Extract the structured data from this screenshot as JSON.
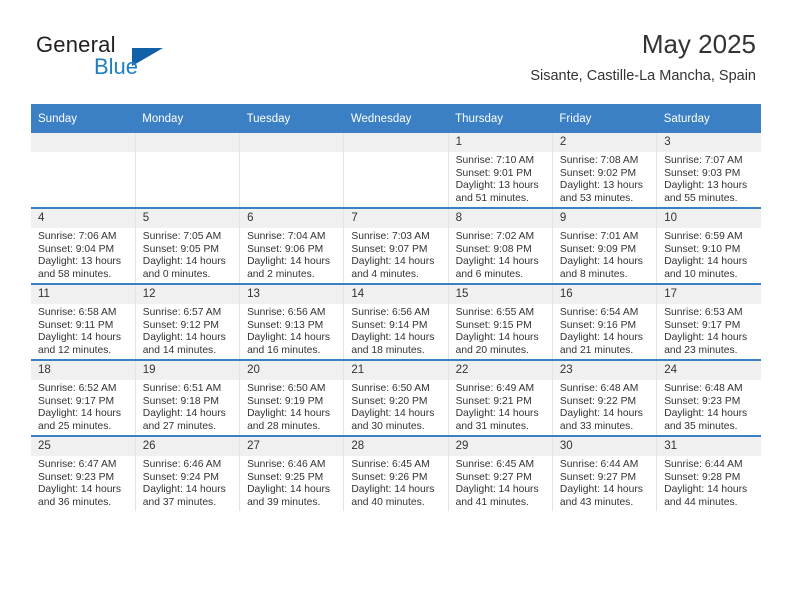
{
  "logo": {
    "word_one": "General",
    "word_two": "Blue",
    "triangle_color": "#1260a8",
    "blue_color": "#1f7fc4"
  },
  "header": {
    "title": "May 2025",
    "subtitle": "Sisante, Castille-La Mancha, Spain"
  },
  "theme": {
    "header_blue": "#3b7fc4",
    "daynum_band": "#f0f0f0",
    "text": "#333333"
  },
  "calendar": {
    "weekday_headers": [
      "Sunday",
      "Monday",
      "Tuesday",
      "Wednesday",
      "Thursday",
      "Friday",
      "Saturday"
    ],
    "weeks": [
      [
        {
          "day": "",
          "empty": true,
          "sunrise": "",
          "sunset": "",
          "daylight_line1": "",
          "daylight_line2": ""
        },
        {
          "day": "",
          "empty": true,
          "sunrise": "",
          "sunset": "",
          "daylight_line1": "",
          "daylight_line2": ""
        },
        {
          "day": "",
          "empty": true,
          "sunrise": "",
          "sunset": "",
          "daylight_line1": "",
          "daylight_line2": ""
        },
        {
          "day": "",
          "empty": true,
          "sunrise": "",
          "sunset": "",
          "daylight_line1": "",
          "daylight_line2": ""
        },
        {
          "day": "1",
          "sunrise": "Sunrise: 7:10 AM",
          "sunset": "Sunset: 9:01 PM",
          "daylight_line1": "Daylight: 13 hours",
          "daylight_line2": "and 51 minutes."
        },
        {
          "day": "2",
          "sunrise": "Sunrise: 7:08 AM",
          "sunset": "Sunset: 9:02 PM",
          "daylight_line1": "Daylight: 13 hours",
          "daylight_line2": "and 53 minutes."
        },
        {
          "day": "3",
          "sunrise": "Sunrise: 7:07 AM",
          "sunset": "Sunset: 9:03 PM",
          "daylight_line1": "Daylight: 13 hours",
          "daylight_line2": "and 55 minutes."
        }
      ],
      [
        {
          "day": "4",
          "sunrise": "Sunrise: 7:06 AM",
          "sunset": "Sunset: 9:04 PM",
          "daylight_line1": "Daylight: 13 hours",
          "daylight_line2": "and 58 minutes."
        },
        {
          "day": "5",
          "sunrise": "Sunrise: 7:05 AM",
          "sunset": "Sunset: 9:05 PM",
          "daylight_line1": "Daylight: 14 hours",
          "daylight_line2": "and 0 minutes."
        },
        {
          "day": "6",
          "sunrise": "Sunrise: 7:04 AM",
          "sunset": "Sunset: 9:06 PM",
          "daylight_line1": "Daylight: 14 hours",
          "daylight_line2": "and 2 minutes."
        },
        {
          "day": "7",
          "sunrise": "Sunrise: 7:03 AM",
          "sunset": "Sunset: 9:07 PM",
          "daylight_line1": "Daylight: 14 hours",
          "daylight_line2": "and 4 minutes."
        },
        {
          "day": "8",
          "sunrise": "Sunrise: 7:02 AM",
          "sunset": "Sunset: 9:08 PM",
          "daylight_line1": "Daylight: 14 hours",
          "daylight_line2": "and 6 minutes."
        },
        {
          "day": "9",
          "sunrise": "Sunrise: 7:01 AM",
          "sunset": "Sunset: 9:09 PM",
          "daylight_line1": "Daylight: 14 hours",
          "daylight_line2": "and 8 minutes."
        },
        {
          "day": "10",
          "sunrise": "Sunrise: 6:59 AM",
          "sunset": "Sunset: 9:10 PM",
          "daylight_line1": "Daylight: 14 hours",
          "daylight_line2": "and 10 minutes."
        }
      ],
      [
        {
          "day": "11",
          "sunrise": "Sunrise: 6:58 AM",
          "sunset": "Sunset: 9:11 PM",
          "daylight_line1": "Daylight: 14 hours",
          "daylight_line2": "and 12 minutes."
        },
        {
          "day": "12",
          "sunrise": "Sunrise: 6:57 AM",
          "sunset": "Sunset: 9:12 PM",
          "daylight_line1": "Daylight: 14 hours",
          "daylight_line2": "and 14 minutes."
        },
        {
          "day": "13",
          "sunrise": "Sunrise: 6:56 AM",
          "sunset": "Sunset: 9:13 PM",
          "daylight_line1": "Daylight: 14 hours",
          "daylight_line2": "and 16 minutes."
        },
        {
          "day": "14",
          "sunrise": "Sunrise: 6:56 AM",
          "sunset": "Sunset: 9:14 PM",
          "daylight_line1": "Daylight: 14 hours",
          "daylight_line2": "and 18 minutes."
        },
        {
          "day": "15",
          "sunrise": "Sunrise: 6:55 AM",
          "sunset": "Sunset: 9:15 PM",
          "daylight_line1": "Daylight: 14 hours",
          "daylight_line2": "and 20 minutes."
        },
        {
          "day": "16",
          "sunrise": "Sunrise: 6:54 AM",
          "sunset": "Sunset: 9:16 PM",
          "daylight_line1": "Daylight: 14 hours",
          "daylight_line2": "and 21 minutes."
        },
        {
          "day": "17",
          "sunrise": "Sunrise: 6:53 AM",
          "sunset": "Sunset: 9:17 PM",
          "daylight_line1": "Daylight: 14 hours",
          "daylight_line2": "and 23 minutes."
        }
      ],
      [
        {
          "day": "18",
          "sunrise": "Sunrise: 6:52 AM",
          "sunset": "Sunset: 9:17 PM",
          "daylight_line1": "Daylight: 14 hours",
          "daylight_line2": "and 25 minutes."
        },
        {
          "day": "19",
          "sunrise": "Sunrise: 6:51 AM",
          "sunset": "Sunset: 9:18 PM",
          "daylight_line1": "Daylight: 14 hours",
          "daylight_line2": "and 27 minutes."
        },
        {
          "day": "20",
          "sunrise": "Sunrise: 6:50 AM",
          "sunset": "Sunset: 9:19 PM",
          "daylight_line1": "Daylight: 14 hours",
          "daylight_line2": "and 28 minutes."
        },
        {
          "day": "21",
          "sunrise": "Sunrise: 6:50 AM",
          "sunset": "Sunset: 9:20 PM",
          "daylight_line1": "Daylight: 14 hours",
          "daylight_line2": "and 30 minutes."
        },
        {
          "day": "22",
          "sunrise": "Sunrise: 6:49 AM",
          "sunset": "Sunset: 9:21 PM",
          "daylight_line1": "Daylight: 14 hours",
          "daylight_line2": "and 31 minutes."
        },
        {
          "day": "23",
          "sunrise": "Sunrise: 6:48 AM",
          "sunset": "Sunset: 9:22 PM",
          "daylight_line1": "Daylight: 14 hours",
          "daylight_line2": "and 33 minutes."
        },
        {
          "day": "24",
          "sunrise": "Sunrise: 6:48 AM",
          "sunset": "Sunset: 9:23 PM",
          "daylight_line1": "Daylight: 14 hours",
          "daylight_line2": "and 35 minutes."
        }
      ],
      [
        {
          "day": "25",
          "sunrise": "Sunrise: 6:47 AM",
          "sunset": "Sunset: 9:23 PM",
          "daylight_line1": "Daylight: 14 hours",
          "daylight_line2": "and 36 minutes."
        },
        {
          "day": "26",
          "sunrise": "Sunrise: 6:46 AM",
          "sunset": "Sunset: 9:24 PM",
          "daylight_line1": "Daylight: 14 hours",
          "daylight_line2": "and 37 minutes."
        },
        {
          "day": "27",
          "sunrise": "Sunrise: 6:46 AM",
          "sunset": "Sunset: 9:25 PM",
          "daylight_line1": "Daylight: 14 hours",
          "daylight_line2": "and 39 minutes."
        },
        {
          "day": "28",
          "sunrise": "Sunrise: 6:45 AM",
          "sunset": "Sunset: 9:26 PM",
          "daylight_line1": "Daylight: 14 hours",
          "daylight_line2": "and 40 minutes."
        },
        {
          "day": "29",
          "sunrise": "Sunrise: 6:45 AM",
          "sunset": "Sunset: 9:27 PM",
          "daylight_line1": "Daylight: 14 hours",
          "daylight_line2": "and 41 minutes."
        },
        {
          "day": "30",
          "sunrise": "Sunrise: 6:44 AM",
          "sunset": "Sunset: 9:27 PM",
          "daylight_line1": "Daylight: 14 hours",
          "daylight_line2": "and 43 minutes."
        },
        {
          "day": "31",
          "sunrise": "Sunrise: 6:44 AM",
          "sunset": "Sunset: 9:28 PM",
          "daylight_line1": "Daylight: 14 hours",
          "daylight_line2": "and 44 minutes."
        }
      ]
    ]
  }
}
